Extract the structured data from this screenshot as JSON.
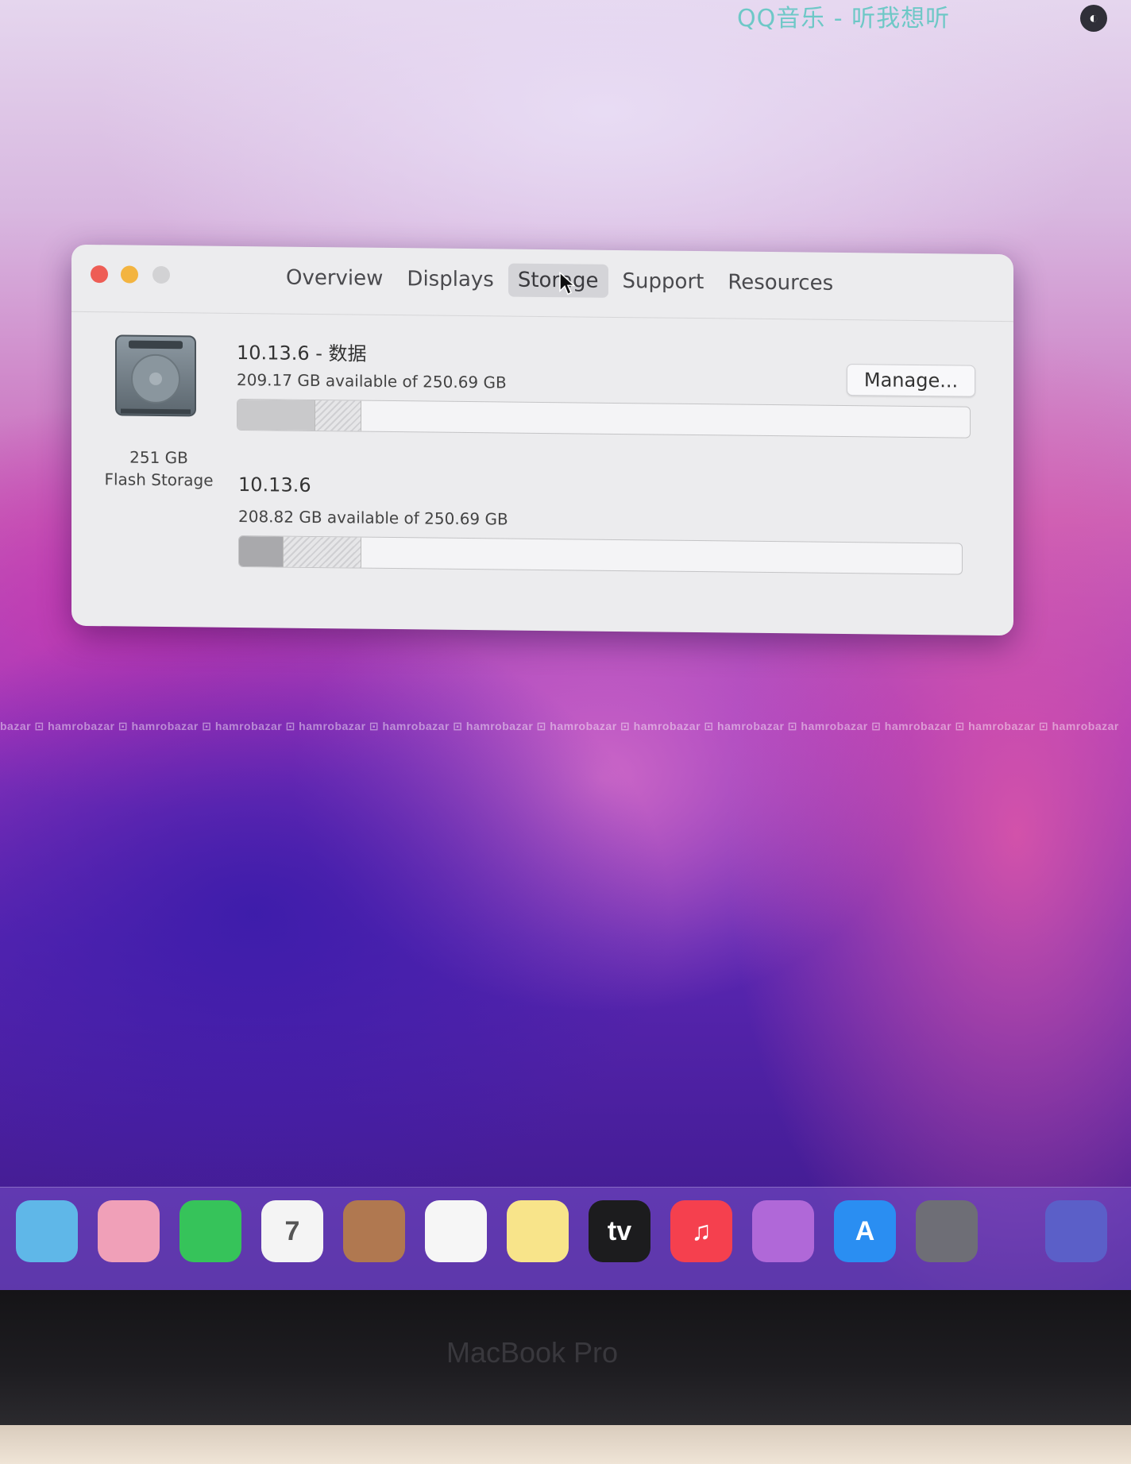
{
  "menubar": {
    "app_title": "QQ音乐 - 听我想听"
  },
  "window": {
    "tabs": [
      {
        "label": "Overview",
        "active": false
      },
      {
        "label": "Displays",
        "active": false
      },
      {
        "label": "Storage",
        "active": true
      },
      {
        "label": "Support",
        "active": false
      },
      {
        "label": "Resources",
        "active": false
      }
    ],
    "disk": {
      "size": "251 GB",
      "type": "Flash Storage"
    },
    "volumes": [
      {
        "name": "10.13.6 - 数据",
        "available": "209.17 GB available of 250.69 GB",
        "used_fraction": 0.105,
        "purgeable_fraction": 0.062
      },
      {
        "name": "10.13.6",
        "available": "208.82 GB available of 250.69 GB",
        "used_fraction": 0.06,
        "purgeable_fraction": 0.107
      }
    ],
    "manage_label": "Manage..."
  },
  "watermark": "bazar ⊡ hamrobazar ⊡ hamrobazar ⊡ hamrobazar ⊡ hamrobazar ⊡ hamrobazar ⊡ hamrobazar ⊡ hamrobazar ⊡ hamrobazar ⊡ hamrobazar ⊡ hamrobazar ⊡ hamrobazar ⊡ hamrobazar ⊡ hamrobazar",
  "dock": {
    "items": [
      {
        "name": "maps-icon",
        "color": "#5fb7e8"
      },
      {
        "name": "photos-icon",
        "color": "#f0a0b8"
      },
      {
        "name": "facetime-icon",
        "color": "#36c35a"
      },
      {
        "name": "calendar-icon",
        "color": "#f4f4f4",
        "text": "7"
      },
      {
        "name": "contacts-icon",
        "color": "#b07850"
      },
      {
        "name": "reminders-icon",
        "color": "#f6f6f6"
      },
      {
        "name": "notes-icon",
        "color": "#f8e48a"
      },
      {
        "name": "apple-tv-icon",
        "color": "#1c1c1e",
        "text": "tv"
      },
      {
        "name": "music-icon",
        "color": "#f5404e",
        "text": "♫"
      },
      {
        "name": "podcasts-icon",
        "color": "#b068d8"
      },
      {
        "name": "app-store-icon",
        "color": "#2a8ef2",
        "text": "A"
      },
      {
        "name": "system-preferences-icon",
        "color": "#6e6e76"
      },
      {
        "name": "downloads-stack-icon",
        "color": "#5b5fc8"
      }
    ]
  },
  "bezel": {
    "brand": "MacBook Pro"
  }
}
